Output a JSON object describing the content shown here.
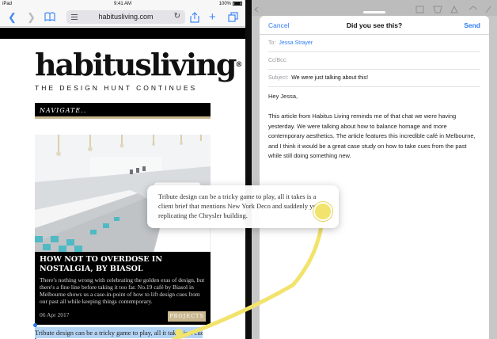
{
  "status_bar": {
    "carrier": "iPad",
    "time": "9:41 AM",
    "battery": "100%"
  },
  "safari": {
    "url": "habitusliving.com",
    "icons": {
      "back": "chevron-left-icon",
      "forward": "chevron-right-icon",
      "bookmarks": "book-icon",
      "reader": "reader-icon",
      "reload": "reload-icon",
      "share": "share-icon",
      "new_tab": "plus-icon",
      "tabs": "tabs-icon"
    }
  },
  "page": {
    "logo": "habitusliving",
    "tagline": "THE DESIGN HUNT CONTINUES",
    "nav_label": "NAVIGATE..",
    "article": {
      "title": "HOW NOT TO OVERDOSE IN NOSTALGIA, BY BIASOL",
      "excerpt": "There's nothing wrong with celebrating the golden eras of design, but there's a fine line before taking it too far. No.19 café by Biasol in Melbourne shows us a case-in-point of how to lift design cues from our past all while keeping things contemporary.",
      "date": "06 Apr 2017",
      "tag": "PROJECTS"
    },
    "selected_text": "Tribute design can be a tricky game to play, all it takes is a client"
  },
  "drag_preview": {
    "text": "Tribute design can be a tricky game to play, all it takes is a client brief that mentions New York Deco and suddenly you're replicating the Chrysler building."
  },
  "mail": {
    "cancel_label": "Cancel",
    "title": "Did you see this?",
    "send_label": "Send",
    "to_label": "To:",
    "to_value": "Jessa Strayer",
    "cc_label": "Cc/Bcc:",
    "subject_label": "Subject:",
    "subject_value": "We were just talking about this!",
    "greeting": "Hey Jessa,",
    "body": "This article from Habitus Living reminds me of that chat we were having yesterday. We were talking about how to balance homage and more contemporary aesthetics. The article features this incredible café in Melbourne, and I think it would be a great case study on how to take cues from the past while still doing something new."
  },
  "colors": {
    "accent": "#2f7cf6",
    "gold": "#c9b78f",
    "drag_highlight": "#f2e36c",
    "selection": "#b3d4f5"
  }
}
